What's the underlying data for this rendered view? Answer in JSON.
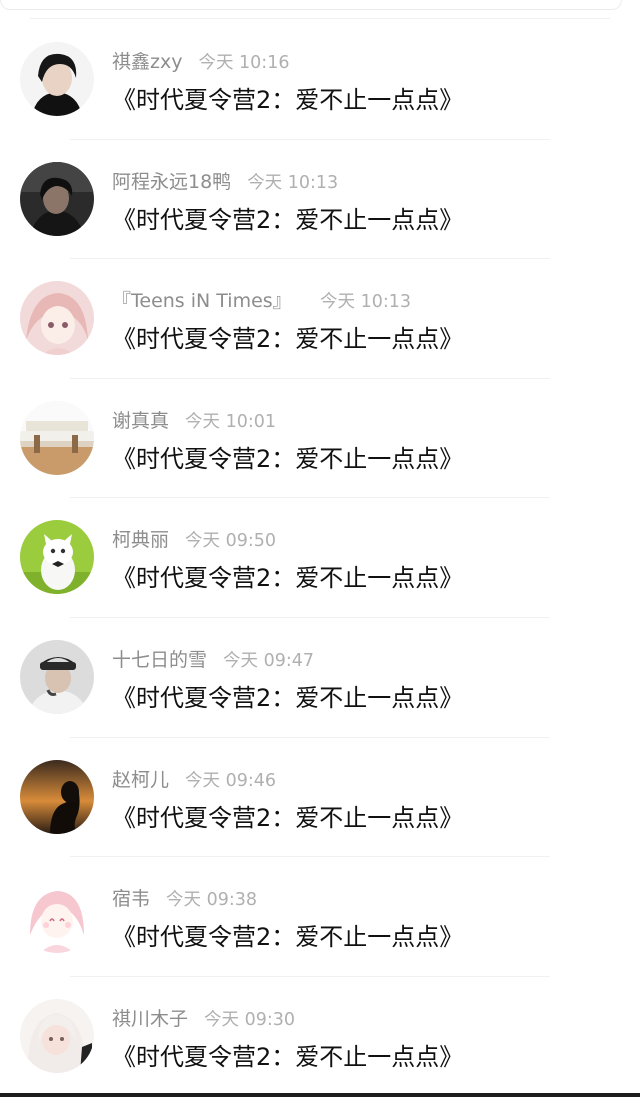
{
  "comments": [
    {
      "username": "祺鑫zxy",
      "time": "今天 10:16",
      "text": "《时代夏令营2：爱不止一点点》"
    },
    {
      "username": "阿程永远18鸭",
      "time": "今天 10:13",
      "text": "《时代夏令营2：爱不止一点点》"
    },
    {
      "username": "『Teens iN Times』",
      "time": "今天 10:13",
      "text": "《时代夏令营2：爱不止一点点》"
    },
    {
      "username": "谢真真",
      "time": "今天 10:01",
      "text": "《时代夏令营2：爱不止一点点》"
    },
    {
      "username": "柯典丽",
      "time": "今天 09:50",
      "text": "《时代夏令营2：爱不止一点点》"
    },
    {
      "username": "十七日的雪",
      "time": "今天 09:47",
      "text": "《时代夏令营2：爱不止一点点》"
    },
    {
      "username": "赵柯儿",
      "time": "今天 09:46",
      "text": "《时代夏令营2：爱不止一点点》"
    },
    {
      "username": "宿韦",
      "time": "今天 09:38",
      "text": "《时代夏令营2：爱不止一点点》"
    },
    {
      "username": "祺川木子",
      "time": "今天 09:30",
      "text": "《时代夏令营2：爱不止一点点》"
    }
  ],
  "colors": {
    "text_primary": "#111111",
    "text_username": "#8d8d8d",
    "text_time": "#b0b0b0",
    "divider": "#f1f1f1"
  }
}
